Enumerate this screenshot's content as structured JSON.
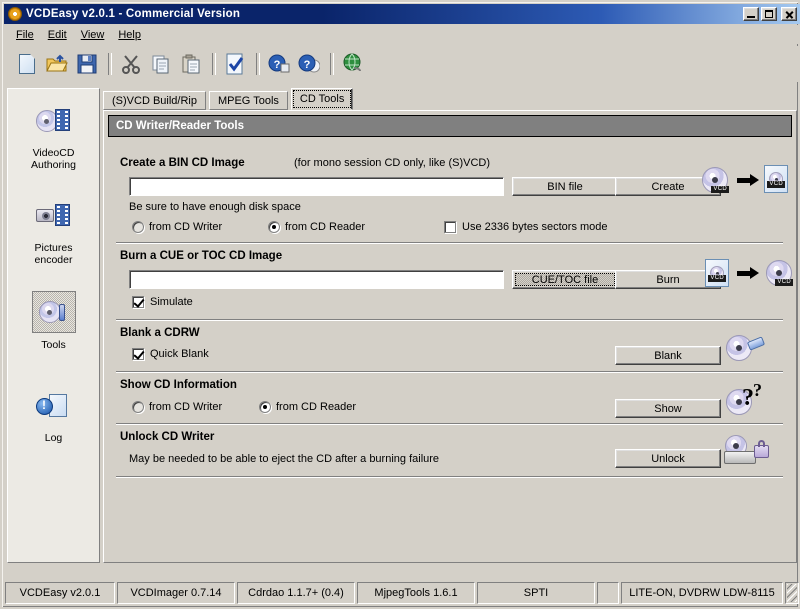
{
  "window": {
    "title": "VCDEasy v2.0.1 - Commercial Version",
    "app_icon": "cd-disc-icon",
    "minimize_label": "_",
    "maximize_label": "□",
    "close_label": "×"
  },
  "menu": [
    {
      "label": "File"
    },
    {
      "label": "Edit"
    },
    {
      "label": "View"
    },
    {
      "label": "Help"
    }
  ],
  "toolbar": [
    {
      "name": "new-document-icon",
      "title": "New"
    },
    {
      "name": "open-folder-icon",
      "title": "Open"
    },
    {
      "name": "save-disk-icon",
      "title": "Save"
    },
    {
      "name": "cut-scissors-icon",
      "title": "Cut"
    },
    {
      "name": "copy-icon",
      "title": "Copy"
    },
    {
      "name": "paste-icon",
      "title": "Paste"
    },
    {
      "name": "check-document-icon",
      "title": "Check"
    },
    {
      "name": "help-context-icon",
      "title": "Context Help"
    },
    {
      "name": "help-question-icon",
      "title": "Help"
    },
    {
      "name": "globe-web-icon",
      "title": "Web"
    }
  ],
  "sidebar": {
    "items": [
      {
        "label": "VideoCD\nAuthoring",
        "line1": "VideoCD",
        "line2": "Authoring",
        "icon": "videocd-authoring-icon",
        "selected": false
      },
      {
        "label": "Pictures encoder",
        "line1": "Pictures",
        "line2": "encoder",
        "icon": "pictures-encoder-icon",
        "selected": false
      },
      {
        "label": "Tools",
        "line1": "Tools",
        "line2": "",
        "icon": "tools-icon",
        "selected": true
      },
      {
        "label": "Log",
        "line1": "Log",
        "line2": "",
        "icon": "log-icon",
        "selected": false
      }
    ]
  },
  "tabs": [
    {
      "label": "(S)VCD Build/Rip",
      "active": false
    },
    {
      "label": "MPEG Tools",
      "active": false
    },
    {
      "label": "CD Tools",
      "active": true
    }
  ],
  "panel": {
    "header": "CD Writer/Reader Tools",
    "sections": {
      "create_bin": {
        "title": "Create a BIN CD Image",
        "note": "(for mono session CD only, like (S)VCD)",
        "path_value": "",
        "path_placeholder": "",
        "hint": "Be sure to have enough disk space",
        "browse_button": "BIN file",
        "action_button": "Create",
        "source_from_writer": "from CD Writer",
        "source_from_reader": "from CD Reader",
        "source_selected": "reader",
        "sectors_checkbox": "Use 2336 bytes sectors mode",
        "sectors_checked": false,
        "icon_left": "cd-disc-vcd-icon",
        "icon_arrow": "arrow-right-icon",
        "icon_right": "bin-file-icon"
      },
      "burn_cue": {
        "title": "Burn a CUE or TOC CD Image",
        "path_value": "",
        "path_placeholder": "",
        "browse_button": "CUE/TOC file",
        "browse_focused": true,
        "action_button": "Burn",
        "simulate_checkbox": "Simulate",
        "simulate_checked": true,
        "icon_left": "cue-file-icon",
        "icon_arrow": "arrow-right-icon",
        "icon_right": "cd-disc-vcd-icon"
      },
      "blank_cdrw": {
        "title": "Blank a CDRW",
        "quick_checkbox": "Quick Blank",
        "quick_checked": true,
        "action_button": "Blank",
        "icon": "disc-eraser-icon"
      },
      "show_info": {
        "title": "Show CD Information",
        "source_from_writer": "from CD Writer",
        "source_from_reader": "from CD Reader",
        "source_selected": "reader",
        "action_button": "Show",
        "icon": "disc-question-icon"
      },
      "unlock": {
        "title": "Unlock CD Writer",
        "hint": "May be needed to be able to eject the CD after a burning failure",
        "action_button": "Unlock",
        "icon": "drive-lock-icon"
      }
    }
  },
  "statusbar": [
    {
      "text": "VCDEasy v2.0.1"
    },
    {
      "text": "VCDImager 0.7.14"
    },
    {
      "text": "Cdrdao 1.1.7+ (0.4)"
    },
    {
      "text": "MjpegTools 1.6.1"
    },
    {
      "text": "SPTI"
    },
    {
      "text": ""
    },
    {
      "text": "LITE-ON, DVDRW LDW-8115"
    }
  ],
  "colors": {
    "face": "#d4d0c8",
    "title_active": "#0a246a",
    "panel_header": "#808080",
    "field_bg": "#ffffff"
  }
}
